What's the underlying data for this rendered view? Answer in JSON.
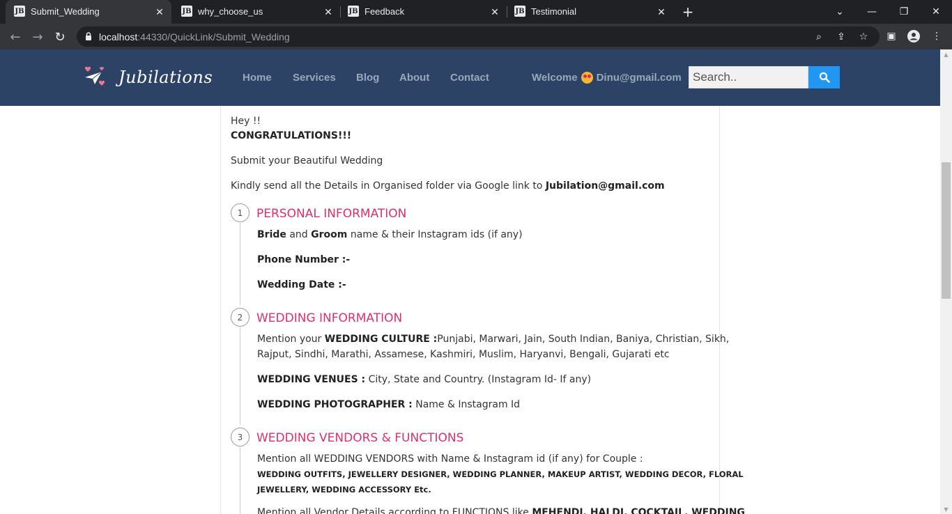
{
  "browser": {
    "tabs": [
      {
        "title": "Submit_Wedding",
        "favicon": "JB",
        "active": true
      },
      {
        "title": "why_choose_us",
        "favicon": "JB",
        "active": false
      },
      {
        "title": "Feedback",
        "favicon": "JB",
        "active": false
      },
      {
        "title": "Testimonial",
        "favicon": "JB",
        "active": false
      }
    ],
    "url_host": "localhost",
    "url_rest": ":44330/QuickLink/Submit_Wedding"
  },
  "site": {
    "logo_text": "Jubilations",
    "nav": [
      "Home",
      "Services",
      "Blog",
      "About",
      "Contact"
    ],
    "welcome_label": "Welcome",
    "user_email": "Dinu@gmail.com",
    "search_placeholder": "Search.."
  },
  "content": {
    "greeting": "Hey !!",
    "congrats": "CONGRATULATIONS!!!",
    "submit_line": "Submit your Beautiful Wedding",
    "kindly_prefix": "Kindly send all the Details in Organised folder via Google link to ",
    "kindly_email": "Jubilation@gmail.com",
    "steps": [
      {
        "number": "1",
        "title": "PERSONAL INFORMATION",
        "bride": "Bride",
        "and": " and ",
        "groom": "Groom",
        "names_rest": " name & their Instagram ids (if any)",
        "phone": "Phone Number :-",
        "wedding_date": "Wedding Date :-"
      },
      {
        "number": "2",
        "title": "WEDDING INFORMATION",
        "culture_prefix": "Mention your ",
        "culture_label": "WEDDING CULTURE :",
        "culture_line1": "Punjabi, Marwari, Jain, South Indian, Baniya, Christian, Sikh,",
        "culture_line2": "Rajput, Sindhi, Marathi, Assamese, Kashmiri, Muslim, Haryanvi, Bengali, Gujarati etc",
        "venues_label": "WEDDING VENUES :",
        "venues_text": " City, State and Country. (Instagram Id- If any)",
        "photographer_label": "WEDDING PHOTOGRAPHER :",
        "photographer_text": " Name & Instagram Id"
      },
      {
        "number": "3",
        "title": "WEDDING VENDORS & FUNCTIONS",
        "vendors_line": "Mention all WEDDING VENDORS with Name & Instagram id (if any) for Couple :",
        "vendors_list1": "WEDDING OUTFITS, JEWELLERY DESIGNER, WEDDING PLANNER, MAKEUP ARTIST, WEDDING DECOR, FLORAL",
        "vendors_list2": "JEWELLERY, WEDDING ACCESSORY Etc.",
        "functions_prefix": "Mention all Vendor Details according to FUNCTIONS like ",
        "functions_bold": "MEHENDI, HALDI, COCKTAIL, WEDDING"
      }
    ]
  }
}
